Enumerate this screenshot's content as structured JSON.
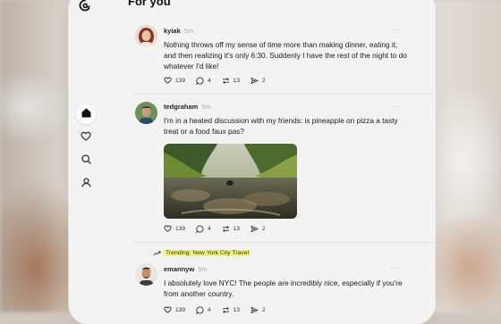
{
  "header": {
    "title": "For you"
  },
  "nav": {
    "items": [
      "home",
      "activity",
      "search",
      "profile"
    ]
  },
  "posts": [
    {
      "username": "kyiak",
      "time": "5m",
      "text": "Nothing throws off my sense of time more than making dinner, eating it, and then realizing it's only 6:30. Suddenly I have the rest of the night to do whatever I'd like!",
      "likes": "139",
      "replies": "4",
      "reposts": "13",
      "shares": "2"
    },
    {
      "username": "tedgraham",
      "time": "5m",
      "text": "I'm in a heated discussion with my friends: is pineapple on pizza a tasty treat or a food faux pas?",
      "likes": "139",
      "replies": "4",
      "reposts": "13",
      "shares": "2"
    },
    {
      "trending_label": "Trending: New York City Travel",
      "username": "emannyw",
      "time": "5m",
      "text": "I absolutely love NYC! The people are incredibly nice, especially if you're from another country.",
      "likes": "139",
      "replies": "4",
      "reposts": "13",
      "shares": "2"
    }
  ],
  "more_label": "···",
  "colors": {
    "trend_highlight": "#f2f27a",
    "window_bg": "#f3f3f3"
  }
}
